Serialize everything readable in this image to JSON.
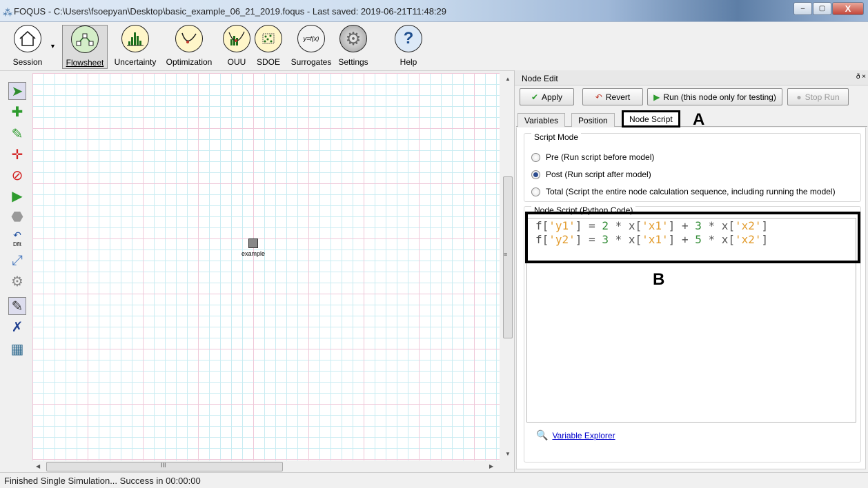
{
  "window": {
    "title": "FOQUS - C:\\Users\\fsoepyan\\Desktop\\basic_example_06_21_2019.foqus - Last saved: 2019-06-21T11:48:29",
    "controls": {
      "minimize": "–",
      "maximize": "▢",
      "close": "X"
    }
  },
  "toolbar": {
    "items": [
      {
        "label": "Session",
        "icon": "house-icon"
      },
      {
        "label": "Flowsheet",
        "icon": "flowsheet-icon",
        "active": true
      },
      {
        "label": "Uncertainty",
        "icon": "histogram-icon"
      },
      {
        "label": "Optimization",
        "icon": "curve-minimum-icon"
      },
      {
        "label": "OUU",
        "icon": "ouu-icon"
      },
      {
        "label": "SDOE",
        "icon": "sdoe-icon"
      },
      {
        "label": "Surrogates",
        "icon": "function-icon"
      },
      {
        "label": "Settings",
        "icon": "gear-icon"
      },
      {
        "label": "Help",
        "icon": "question-icon"
      }
    ]
  },
  "canvas": {
    "node_label": "example",
    "side_tools": [
      "select-arrow-icon",
      "add-node-icon",
      "add-edge-icon",
      "center-icon",
      "delete-icon",
      "run-icon",
      "stop-icon",
      "default-icon",
      "link-icon",
      "settings-icon",
      "edit-icon",
      "no-edit-icon",
      "table-icon"
    ],
    "default_tool_text": "Dflt",
    "scrollbar_grip": "III",
    "vscroll_grip": "≡"
  },
  "node_edit": {
    "title": "Node Edit",
    "header_controls": "ð ×",
    "buttons": {
      "apply": "Apply",
      "revert": "Revert",
      "run": "Run (this node only for testing)",
      "stop": "Stop Run"
    },
    "tabs": [
      "Variables",
      "Position",
      "Node Script"
    ],
    "active_tab": "Node Script",
    "annotation_a": "A",
    "annotation_b": "B",
    "script_mode": {
      "title": "Script Mode",
      "options": [
        "Pre (Run script before model)",
        "Post (Run script after model)",
        "Total (Script the entire node calculation sequence, including running the model)"
      ],
      "selected": "Post (Run script after model)"
    },
    "script": {
      "title": "Node Script (Python Code)",
      "lines": [
        "f['y1'] = 2 * x['x1'] + 3 * x['x2']",
        "f['y2'] = 3 * x['x1'] + 5 * x['x2']"
      ]
    },
    "variable_explorer": "Variable Explorer"
  },
  "status_bar": {
    "text": "Finished Single Simulation... Success in 00:00:00"
  }
}
